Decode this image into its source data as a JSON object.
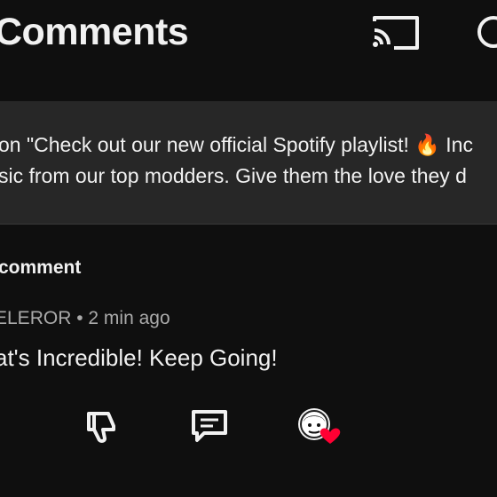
{
  "header": {
    "title": "Comments",
    "cast_icon": "cast-icon",
    "search_icon": "search-icon"
  },
  "pinned_post": {
    "line1": "on \"Check out our new official Spotify playlist! 🔥 Inc",
    "line2": "sic from our top modders. Give them the love they d"
  },
  "comments": {
    "count_label": "comment",
    "items": [
      {
        "author": "ELEROR",
        "time": "2 min ago",
        "separator": "•",
        "text": "at's Incredible! Keep Going!",
        "actions": {
          "dislike_icon": "thumbs-down-icon",
          "reply_icon": "reply-comment-icon",
          "creator_heart_icon": "creator-heart-avatar-icon"
        }
      }
    ]
  },
  "colors": {
    "background": "#0f0f0f",
    "banner": "#272727",
    "text": "#f1f1f1",
    "secondary_text": "#aaaaaa",
    "heart": "#ff0033"
  }
}
